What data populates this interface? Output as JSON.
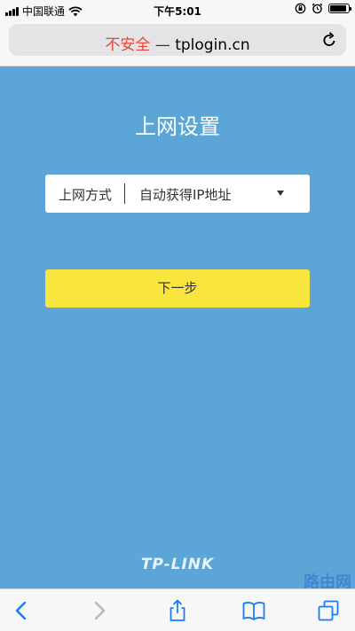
{
  "status_bar": {
    "carrier": "中国联通",
    "time": "下午5:01",
    "battery_level": 0.9
  },
  "address_bar": {
    "security_label": "不安全",
    "separator": "—",
    "domain": "tplogin.cn"
  },
  "page": {
    "title": "上网设置",
    "connection": {
      "label": "上网方式",
      "selected_value": "自动获得IP地址"
    },
    "next_button_label": "下一步",
    "brand": "TP-LINK",
    "watermark": "路由网"
  },
  "colors": {
    "page_background": "#5ba6d6",
    "button_yellow": "#f8e53d",
    "not_secure_red": "#e8453c",
    "ios_blue": "#1b7cf6"
  },
  "icons": {
    "status_left": [
      "signal-bars-icon",
      "wifi-icon"
    ],
    "status_right": [
      "orientation-lock-icon",
      "alarm-icon",
      "battery-icon"
    ],
    "address": [
      "reload-icon"
    ],
    "toolbar": [
      "back-icon",
      "forward-icon",
      "share-icon",
      "bookmarks-icon",
      "tabs-icon"
    ]
  }
}
